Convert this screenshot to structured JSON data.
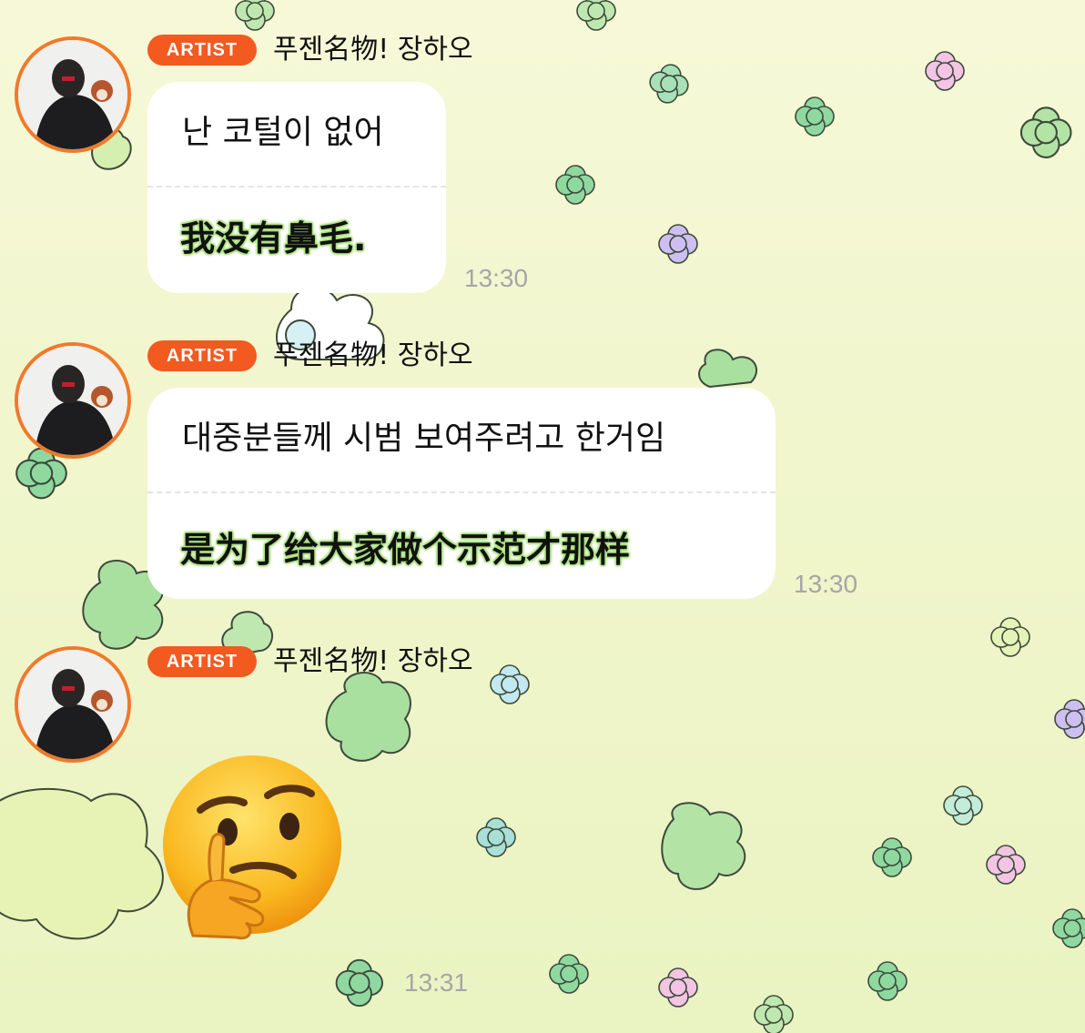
{
  "messages": [
    {
      "badge": "ARTIST",
      "sender": "푸젠名物!  장하오",
      "text_ko": "난 코털이 없어",
      "text_zh": "我没有鼻毛.",
      "time": "13:30"
    },
    {
      "badge": "ARTIST",
      "sender": "푸젠名物!  장하오",
      "text_ko": "대중분들께 시범 보여주려고 한거임",
      "text_zh": "是为了给大家做个示范才那样",
      "time": "13:30"
    },
    {
      "badge": "ARTIST",
      "sender": "푸젠名物!  장하오",
      "emoji": "thinking-face",
      "time": "13:31"
    }
  ],
  "colors": {
    "badge": "#f25a20",
    "avatar_ring": "#f07a2a",
    "subtitle_glow": "#a8df7c",
    "timestamp": "#a6a6a6"
  }
}
